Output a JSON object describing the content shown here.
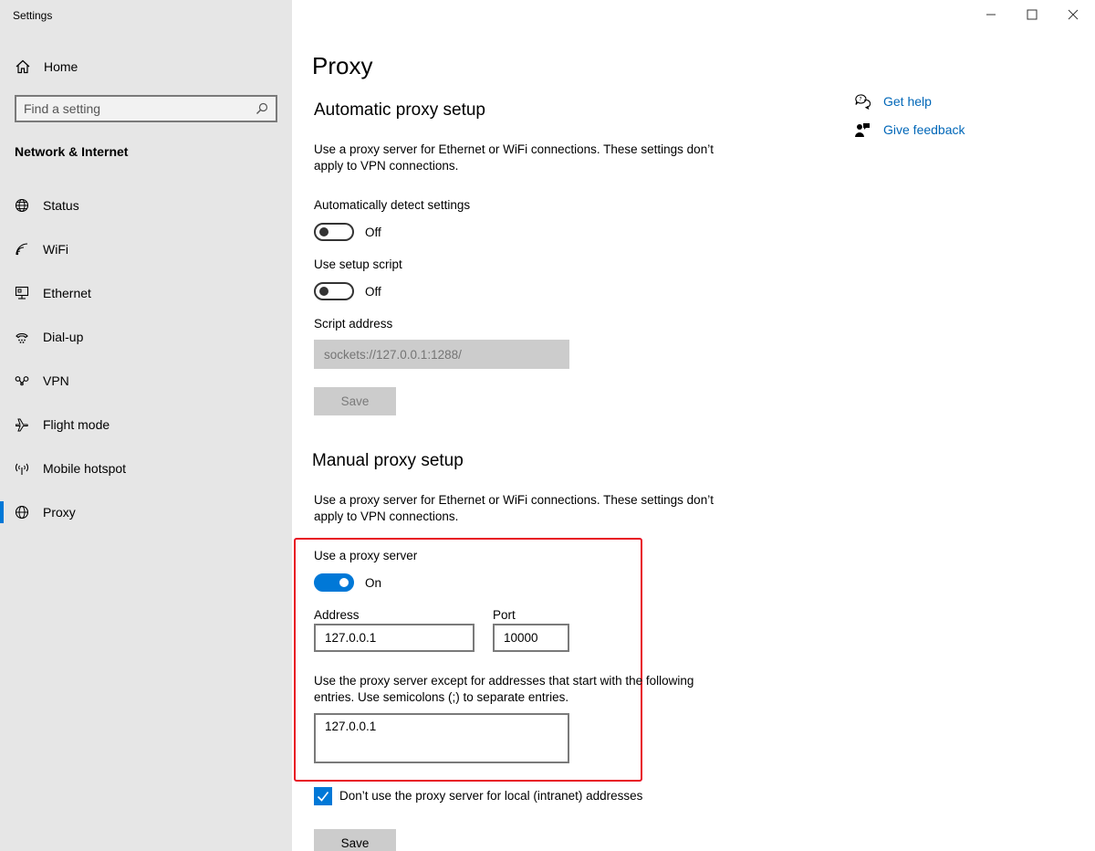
{
  "window": {
    "app_title": "Settings"
  },
  "sidebar": {
    "home_label": "Home",
    "search_placeholder": "Find a setting",
    "section_title": "Network & Internet",
    "items": [
      {
        "label": "Status",
        "icon": "globe-icon"
      },
      {
        "label": "WiFi",
        "icon": "wifi-icon"
      },
      {
        "label": "Ethernet",
        "icon": "ethernet-icon"
      },
      {
        "label": "Dial-up",
        "icon": "dial-up-icon"
      },
      {
        "label": "VPN",
        "icon": "vpn-icon"
      },
      {
        "label": "Flight mode",
        "icon": "airplane-icon"
      },
      {
        "label": "Mobile hotspot",
        "icon": "hotspot-icon"
      },
      {
        "label": "Proxy",
        "icon": "globe-icon",
        "selected": true
      }
    ]
  },
  "main": {
    "page_title": "Proxy",
    "automatic": {
      "heading": "Automatic proxy setup",
      "description": "Use a proxy server for Ethernet or WiFi connections. These settings don’t apply to VPN connections.",
      "detect_label": "Automatically detect settings",
      "detect_state": "Off",
      "script_label": "Use setup script",
      "script_state": "Off",
      "address_label": "Script address",
      "address_placeholder": "sockets://127.0.0.1:1288/",
      "save_label": "Save"
    },
    "manual": {
      "heading": "Manual proxy setup",
      "description": "Use a proxy server for Ethernet or WiFi connections. These settings don’t apply to VPN connections.",
      "use_proxy_label": "Use a proxy server",
      "use_proxy_state": "On",
      "address_label": "Address",
      "address_value": "127.0.0.1",
      "port_label": "Port",
      "port_value": "10000",
      "exceptions_description": "Use the proxy server except for addresses that start with the following entries. Use semicolons (;) to separate entries.",
      "exceptions_value": "127.0.0.1",
      "local_checkbox_label": "Don’t use the proxy server for local (intranet) addresses",
      "local_checkbox_checked": true,
      "save_label": "Save"
    },
    "help": {
      "get_help": "Get help",
      "give_feedback": "Give feedback"
    }
  },
  "colors": {
    "accent": "#0078d7",
    "link": "#0067b8",
    "highlight_box": "#e81123",
    "sidebar_bg": "#e6e6e6"
  }
}
